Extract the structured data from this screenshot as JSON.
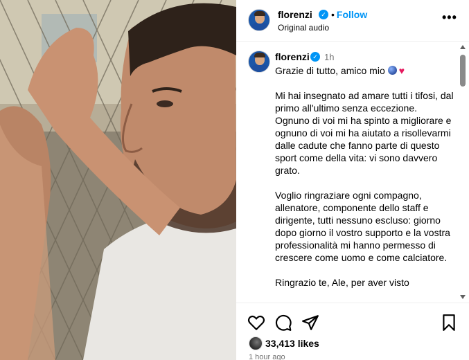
{
  "post": {
    "username": "florenzi",
    "follow_label": "Follow",
    "separator": "•",
    "audio_label": "Original audio",
    "more_label": "•••"
  },
  "caption": {
    "username": "florenzi",
    "time": "1h",
    "greeting": "Grazie di tutto, amico mio",
    "paragraph_1": "Mi hai insegnato ad amare tutti i tifosi, dal primo all'ultimo senza eccezione. Ognuno di voi mi ha spinto a migliorare e ognuno di voi mi ha aiutato a risollevarmi dalle cadute che fanno parte di questo sport come della vita: vi sono davvero grato.",
    "paragraph_2": "Voglio ringraziare ogni compagno, allenatore, componente dello staff e dirigente, tutti nessuno escluso: giorno dopo giorno il vostro supporto e la vostra professionalità mi hanno permesso di crescere come uomo e come calciatore.",
    "paragraph_3": "Ringrazio te, Ale, per aver visto"
  },
  "actions": {
    "likes": "33,413 likes",
    "posted": "1 hour ago",
    "icons": [
      "heart-icon",
      "comment-icon",
      "share-icon",
      "bookmark-icon"
    ]
  },
  "colors": {
    "accent": "#0095f6",
    "heart_emoji": "#e5195e",
    "muted_text": "#737373"
  }
}
